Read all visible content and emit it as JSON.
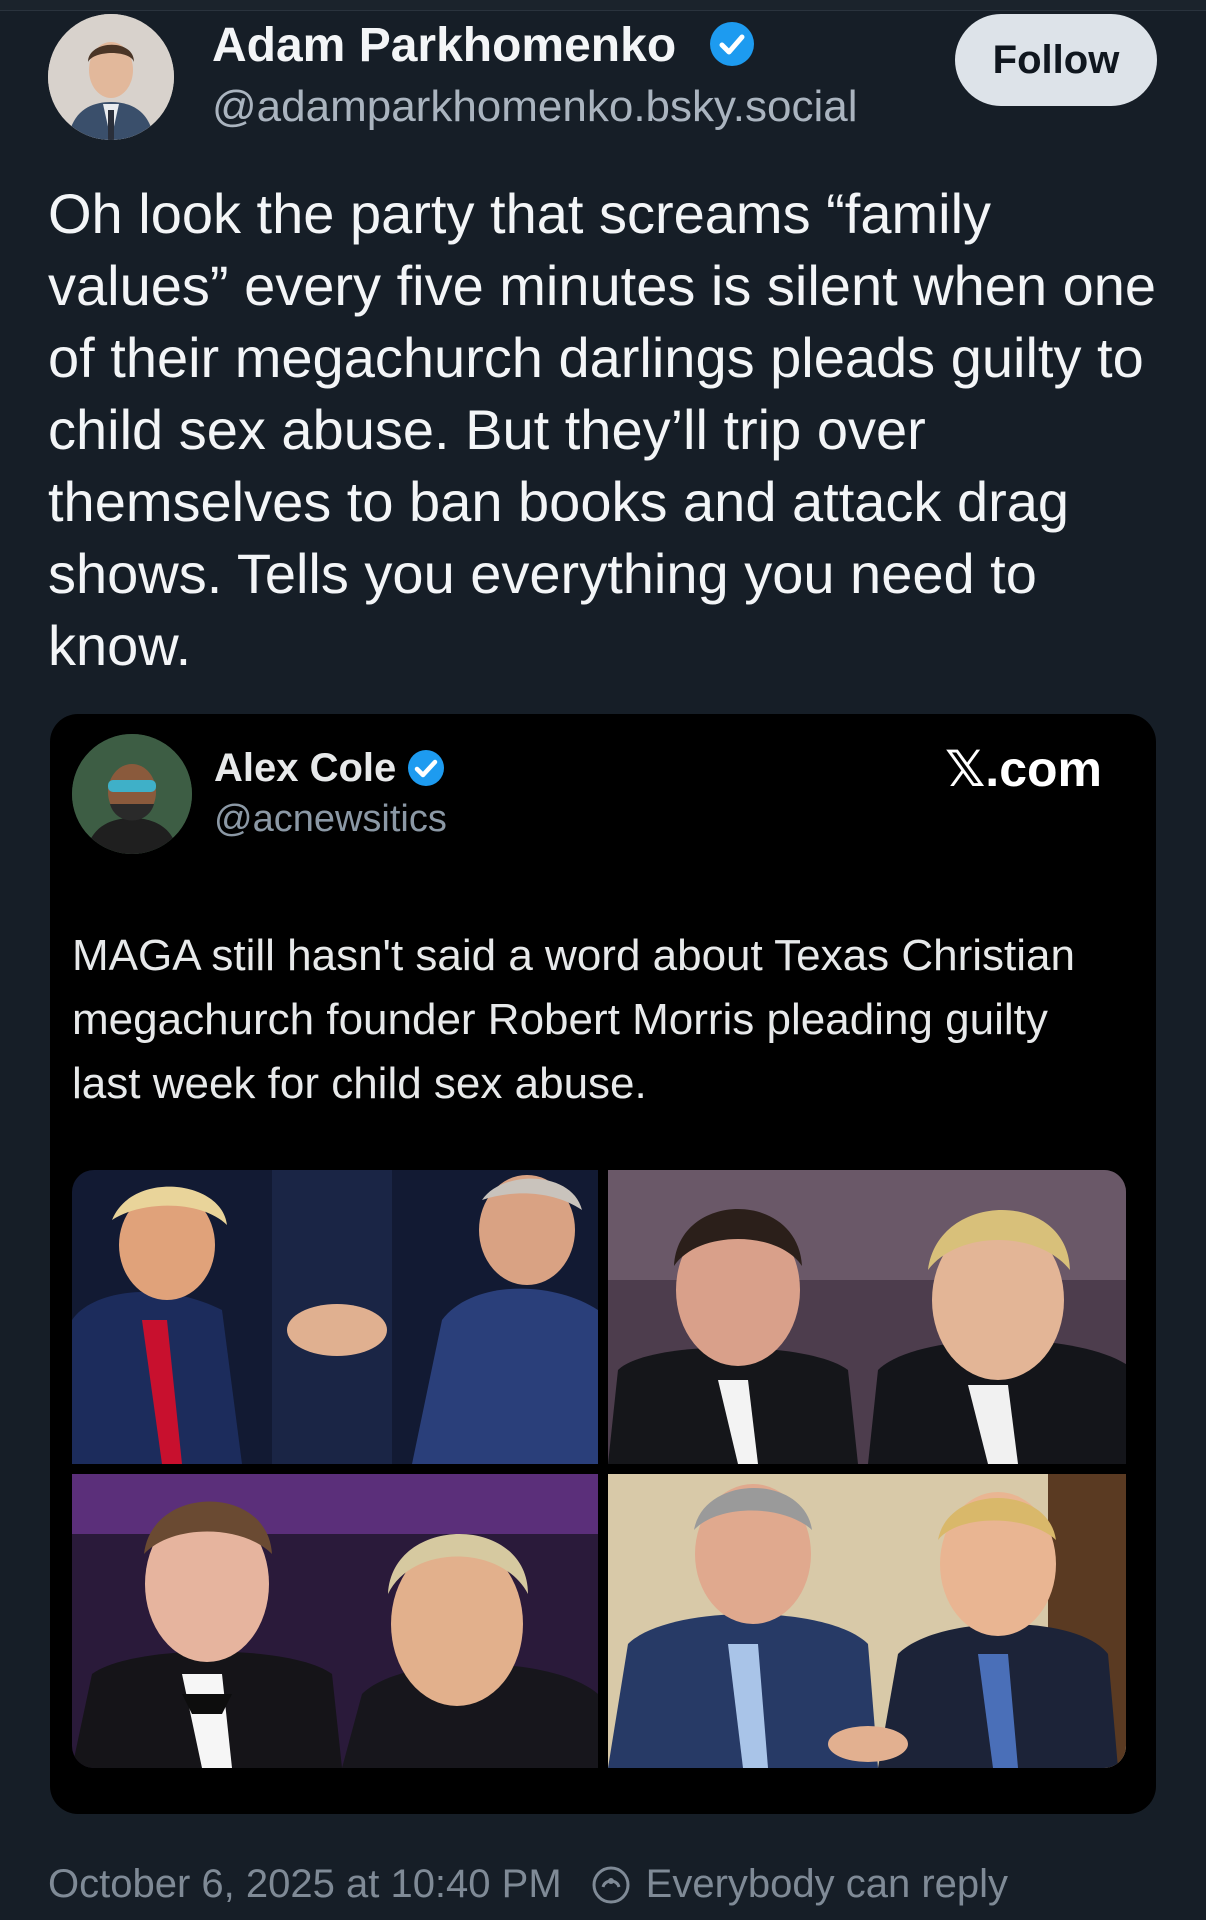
{
  "post": {
    "author_name": "Adam Parkhomenko",
    "author_handle": "@adamparkhomenko.bsky.social",
    "follow_label": "Follow",
    "text": "Oh look the party that screams “family values” every five minutes is silent when one of their megachurch darlings pleads guilty to child sex abuse. But they’ll trip over themselves to ban books and attack drag shows. Tells you everything you need to know.",
    "timestamp": "October 6, 2025 at 10:40 PM",
    "reply_setting": "Everybody can reply"
  },
  "embed": {
    "author_name": "Alex Cole",
    "author_handle": "@acnewsitics",
    "source": "𝕏.com",
    "text": "MAGA still hasn't said a word about Texas Christian megachurch founder Robert Morris pleading guilty last week for child sex abuse."
  },
  "colors": {
    "background": "#161e27",
    "verified_blue": "#1d9bf0",
    "muted_text": "#aab4bf"
  },
  "icons": [
    "verified-badge-icon",
    "reply-setting-icon"
  ]
}
